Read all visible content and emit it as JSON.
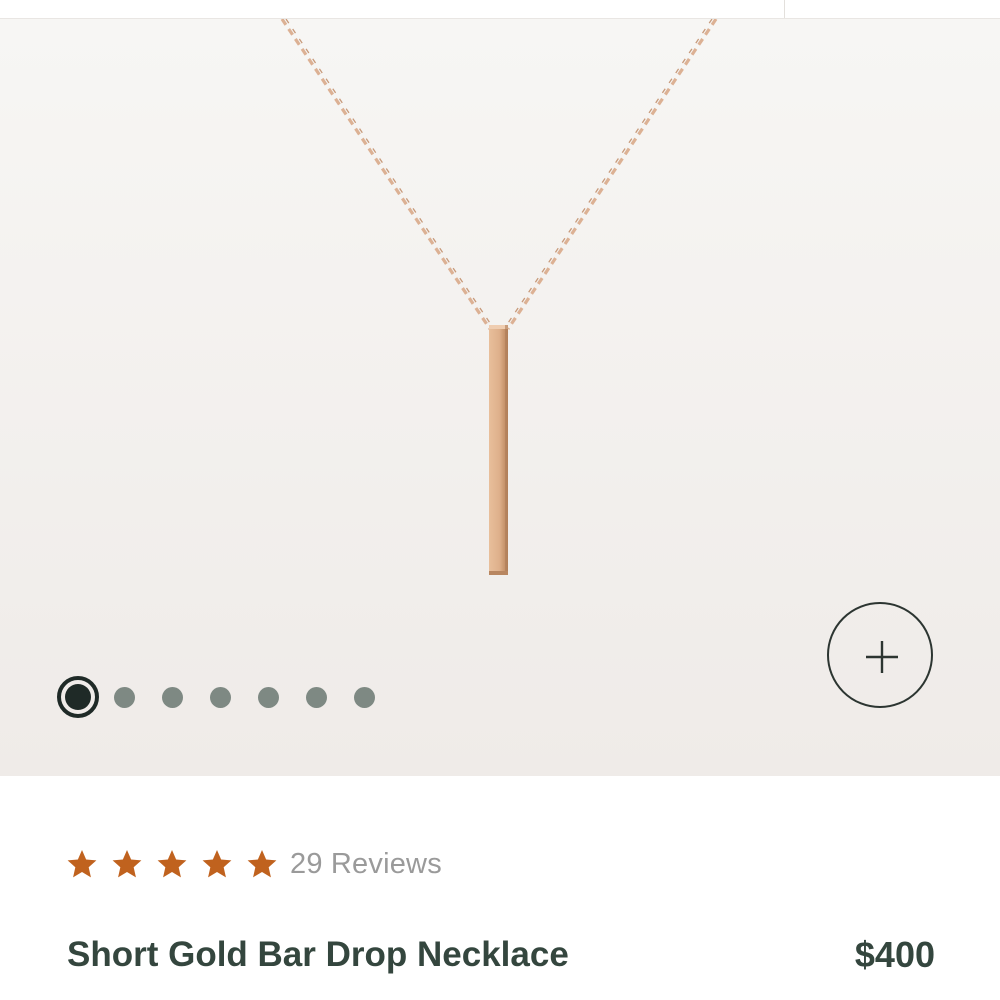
{
  "gallery": {
    "image_alt": "Short Gold Bar Drop Necklace product image",
    "carousel_total": 7,
    "carousel_active_index": 0,
    "zoom_icon": "plus-icon"
  },
  "product": {
    "rating_stars": 5,
    "star_icon": "star-icon",
    "star_color": "#c0621e",
    "reviews_label": "29 Reviews",
    "title": "Short Gold Bar Drop Necklace",
    "price": "$400"
  },
  "colors": {
    "text_primary": "#34463e",
    "dot_active": "#1f2a27",
    "dot_inactive": "#7e8983",
    "reviews_text": "#9a9a9a"
  }
}
